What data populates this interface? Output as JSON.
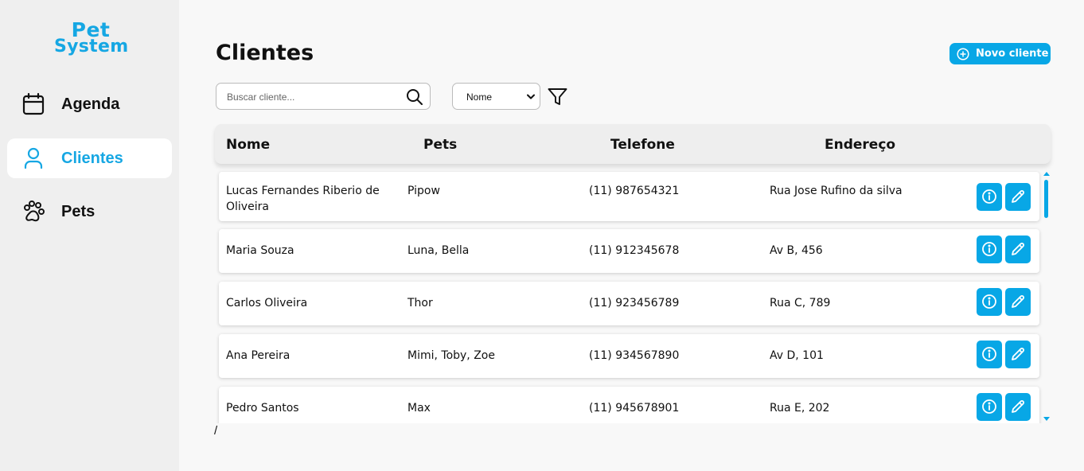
{
  "brand": {
    "line1": "Pet",
    "line2": "System",
    "color": "#16a7e3"
  },
  "sidebar": {
    "items": [
      {
        "label": "Agenda",
        "icon": "calendar-icon",
        "active": false
      },
      {
        "label": "Clientes",
        "icon": "user-icon",
        "active": true
      },
      {
        "label": "Pets",
        "icon": "paw-icon",
        "active": false
      }
    ]
  },
  "page": {
    "title": "Clientes"
  },
  "toolbar": {
    "new_button_label": "Novo cliente",
    "search_placeholder": "Buscar cliente...",
    "sort_selected": "Nome"
  },
  "table": {
    "headers": [
      "Nome",
      "Pets",
      "Telefone",
      "Endereço"
    ],
    "rows": [
      {
        "nome": "Lucas Fernandes Riberio de Oliveira",
        "pets": "Pipow",
        "telefone": "(11) 987654321",
        "endereco": "Rua Jose Rufino da silva"
      },
      {
        "nome": "Maria Souza",
        "pets": "Luna, Bella",
        "telefone": "(11) 912345678",
        "endereco": "Av B, 456"
      },
      {
        "nome": "Carlos Oliveira",
        "pets": "Thor",
        "telefone": "(11) 923456789",
        "endereco": "Rua C, 789"
      },
      {
        "nome": "Ana Pereira",
        "pets": "Mimi, Toby, Zoe",
        "telefone": "(11) 934567890",
        "endereco": "Av D, 101"
      },
      {
        "nome": "Pedro Santos",
        "pets": "Max",
        "telefone": "(11) 945678901",
        "endereco": "Rua E, 202"
      }
    ]
  },
  "footer_text": "/",
  "colors": {
    "accent": "#08a7e6",
    "sidebar_bg": "#efefef",
    "page_bg": "#f8f8f8"
  }
}
